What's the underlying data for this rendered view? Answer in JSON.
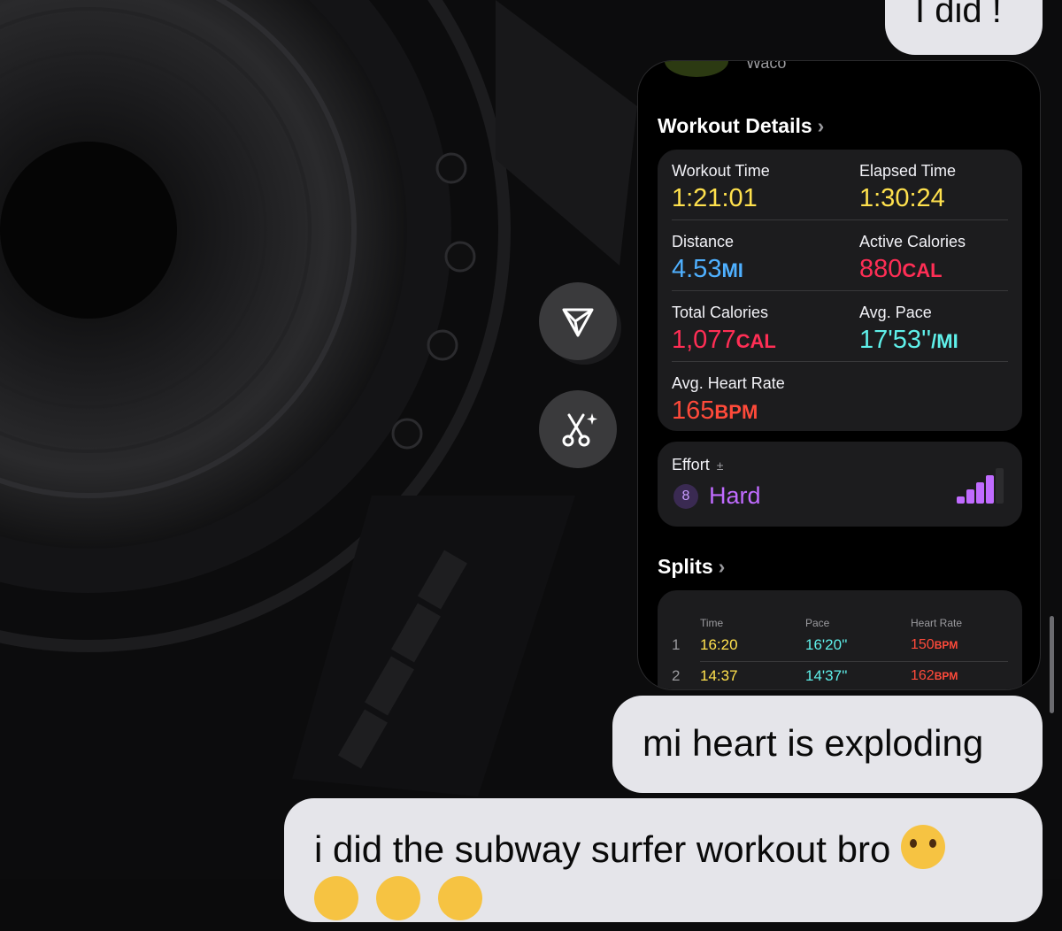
{
  "messages": {
    "top": "I did !",
    "middle": "mi heart is exploding",
    "bottom": "i did the subway surfer workout bro"
  },
  "card": {
    "peek_text": "Waco",
    "details_title": "Workout Details",
    "chevron": "›",
    "stats": {
      "workout_time": {
        "label": "Workout Time",
        "value": "1:21:01"
      },
      "elapsed_time": {
        "label": "Elapsed Time",
        "value": "1:30:24"
      },
      "distance": {
        "label": "Distance",
        "value": "4.53",
        "unit": "MI"
      },
      "active_calories": {
        "label": "Active Calories",
        "value": "880",
        "unit": "CAL"
      },
      "total_calories": {
        "label": "Total Calories",
        "value": "1,077",
        "unit": "CAL"
      },
      "avg_pace": {
        "label": "Avg. Pace",
        "value": "17'53''",
        "unit": "/MI"
      },
      "avg_heart_rate": {
        "label": "Avg. Heart Rate",
        "value": "165",
        "unit": "BPM"
      }
    },
    "effort": {
      "label": "Effort",
      "plusminus": "±",
      "score": "8",
      "value": "Hard",
      "level_fraction": 0.8
    },
    "splits_title": "Splits",
    "splits": {
      "headers": {
        "time": "Time",
        "pace": "Pace",
        "heart_rate": "Heart Rate"
      },
      "rows": [
        {
          "index": "1",
          "time": "16:20",
          "pace": "16'20''",
          "hr": "150",
          "unit": "BPM"
        },
        {
          "index": "2",
          "time": "14:37",
          "pace": "14'37''",
          "hr": "162",
          "unit": "BPM"
        }
      ]
    }
  },
  "colors": {
    "time": "#ffe14d",
    "distance": "#4fb0ff",
    "calories": "#ff2e55",
    "pace": "#5ff0ea",
    "heart_rate": "#ff4a3a",
    "effort": "#c06bff",
    "bubble": "#e5e5ea"
  },
  "icons": {
    "share": "share-arrow-icon",
    "tapback": "scissors-sparkle-icon",
    "emoji": "loudly-crying-face"
  }
}
